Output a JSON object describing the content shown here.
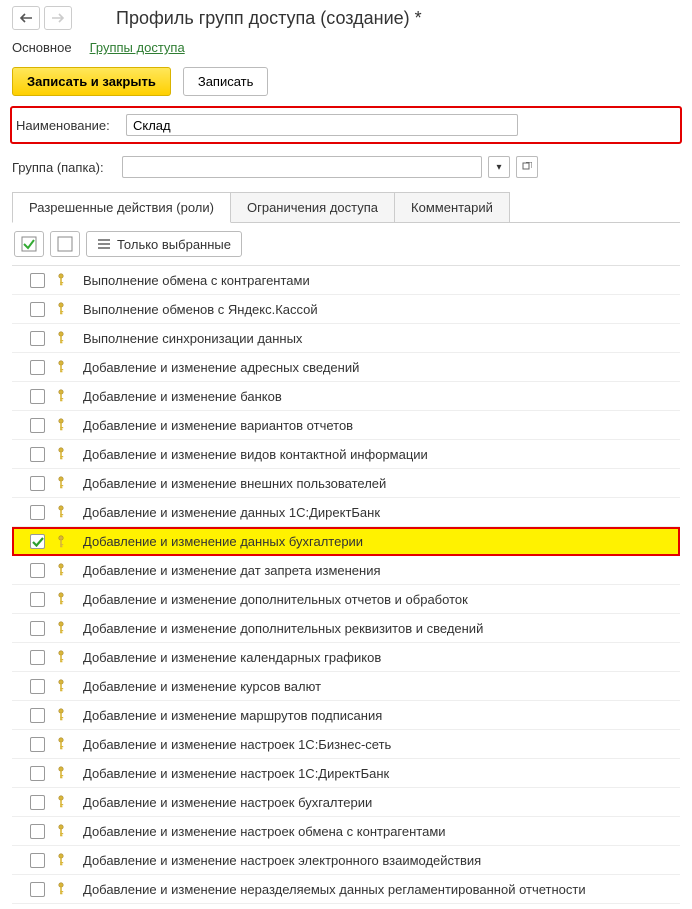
{
  "header": {
    "title": "Профиль групп доступа (создание) *"
  },
  "main_tabs": {
    "basic": "Основное",
    "groups": "Группы доступа"
  },
  "actions": {
    "write_close": "Записать и закрыть",
    "write": "Записать"
  },
  "fields": {
    "name_label": "Наименование:",
    "name_value": "Склад",
    "group_label": "Группа (папка):",
    "group_value": ""
  },
  "subtabs": {
    "roles": "Разрешенные действия (роли)",
    "restrictions": "Ограничения доступа",
    "comment": "Комментарий"
  },
  "roles_toolbar": {
    "only_selected": "Только выбранные"
  },
  "roles": [
    {
      "checked": false,
      "label": "Выполнение обмена с контрагентами"
    },
    {
      "checked": false,
      "label": "Выполнение обменов с Яндекс.Кассой"
    },
    {
      "checked": false,
      "label": "Выполнение синхронизации данных"
    },
    {
      "checked": false,
      "label": "Добавление и изменение адресных сведений"
    },
    {
      "checked": false,
      "label": "Добавление и изменение банков"
    },
    {
      "checked": false,
      "label": "Добавление и изменение вариантов отчетов"
    },
    {
      "checked": false,
      "label": "Добавление и изменение видов контактной информации"
    },
    {
      "checked": false,
      "label": "Добавление и изменение внешних пользователей"
    },
    {
      "checked": false,
      "label": "Добавление и изменение данных 1С:ДиректБанк"
    },
    {
      "checked": true,
      "label": "Добавление и изменение данных бухгалтерии",
      "highlighted": true
    },
    {
      "checked": false,
      "label": "Добавление и изменение дат запрета изменения"
    },
    {
      "checked": false,
      "label": "Добавление и изменение дополнительных отчетов и обработок"
    },
    {
      "checked": false,
      "label": "Добавление и изменение дополнительных реквизитов и сведений"
    },
    {
      "checked": false,
      "label": "Добавление и изменение календарных графиков"
    },
    {
      "checked": false,
      "label": "Добавление и изменение курсов валют"
    },
    {
      "checked": false,
      "label": "Добавление и изменение маршрутов подписания"
    },
    {
      "checked": false,
      "label": "Добавление и изменение настроек 1С:Бизнес-сеть"
    },
    {
      "checked": false,
      "label": "Добавление и изменение настроек 1С:ДиректБанк"
    },
    {
      "checked": false,
      "label": "Добавление и изменение настроек бухгалтерии"
    },
    {
      "checked": false,
      "label": "Добавление и изменение настроек обмена с контрагентами"
    },
    {
      "checked": false,
      "label": "Добавление и изменение настроек электронного взаимодействия"
    },
    {
      "checked": false,
      "label": "Добавление и изменение неразделяемых данных регламентированной отчетности"
    }
  ]
}
